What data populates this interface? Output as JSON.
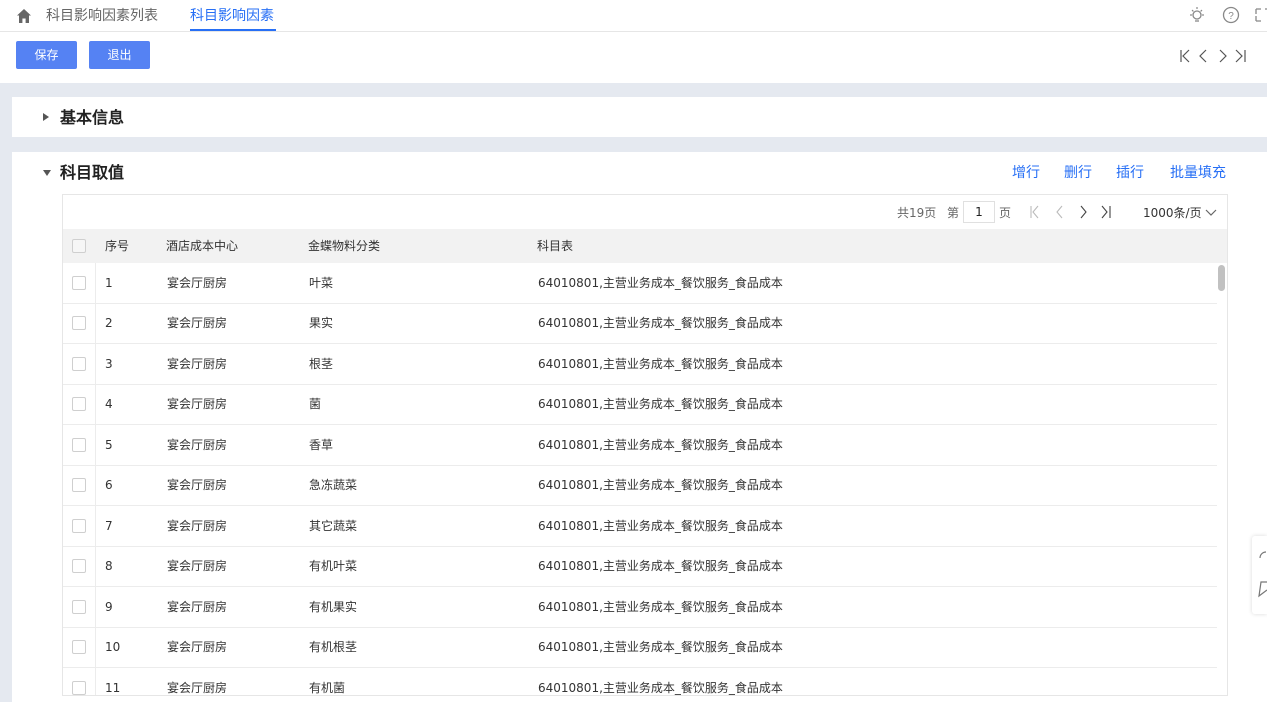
{
  "header": {
    "tabs": [
      {
        "label": "科目影响因素列表"
      },
      {
        "label": "科目影响因素"
      }
    ],
    "icons": [
      "home-icon",
      "lightbulb-icon",
      "help-icon",
      "fullscreen-icon"
    ]
  },
  "toolbar": {
    "save_label": "保存",
    "exit_label": "退出",
    "nav_icons": [
      "first-record-icon",
      "prev-record-icon",
      "next-record-icon",
      "last-record-icon"
    ],
    "accent": "#5582f3"
  },
  "basic_section": {
    "title": "基本信息"
  },
  "subject_section": {
    "title": "科目取值",
    "actions": {
      "add_row": "增行",
      "delete_row": "删行",
      "insert_row": "插行",
      "batch_fill": "批量填充"
    }
  },
  "pager": {
    "total_pages": "共19页",
    "page_prefix": "第",
    "page_value": "1",
    "page_suffix": "页",
    "page_size": "1000条/页"
  },
  "table": {
    "columns": [
      "序号",
      "酒店成本中心",
      "金蝶物料分类",
      "科目表"
    ],
    "rows": [
      {
        "no": "1",
        "center": "宴会厅厨房",
        "category": "叶菜",
        "account": "64010801,主营业务成本_餐饮服务_食品成本"
      },
      {
        "no": "2",
        "center": "宴会厅厨房",
        "category": "果实",
        "account": "64010801,主营业务成本_餐饮服务_食品成本"
      },
      {
        "no": "3",
        "center": "宴会厅厨房",
        "category": "根茎",
        "account": "64010801,主营业务成本_餐饮服务_食品成本"
      },
      {
        "no": "4",
        "center": "宴会厅厨房",
        "category": "菌",
        "account": "64010801,主营业务成本_餐饮服务_食品成本"
      },
      {
        "no": "5",
        "center": "宴会厅厨房",
        "category": "香草",
        "account": "64010801,主营业务成本_餐饮服务_食品成本"
      },
      {
        "no": "6",
        "center": "宴会厅厨房",
        "category": "急冻蔬菜",
        "account": "64010801,主营业务成本_餐饮服务_食品成本"
      },
      {
        "no": "7",
        "center": "宴会厅厨房",
        "category": "其它蔬菜",
        "account": "64010801,主营业务成本_餐饮服务_食品成本"
      },
      {
        "no": "8",
        "center": "宴会厅厨房",
        "category": "有机叶菜",
        "account": "64010801,主营业务成本_餐饮服务_食品成本"
      },
      {
        "no": "9",
        "center": "宴会厅厨房",
        "category": "有机果实",
        "account": "64010801,主营业务成本_餐饮服务_食品成本"
      },
      {
        "no": "10",
        "center": "宴会厅厨房",
        "category": "有机根茎",
        "account": "64010801,主营业务成本_餐饮服务_食品成本"
      },
      {
        "no": "11",
        "center": "宴会厅厨房",
        "category": "有机菌",
        "account": "64010801,主营业务成本_餐饮服务_食品成本"
      }
    ]
  }
}
